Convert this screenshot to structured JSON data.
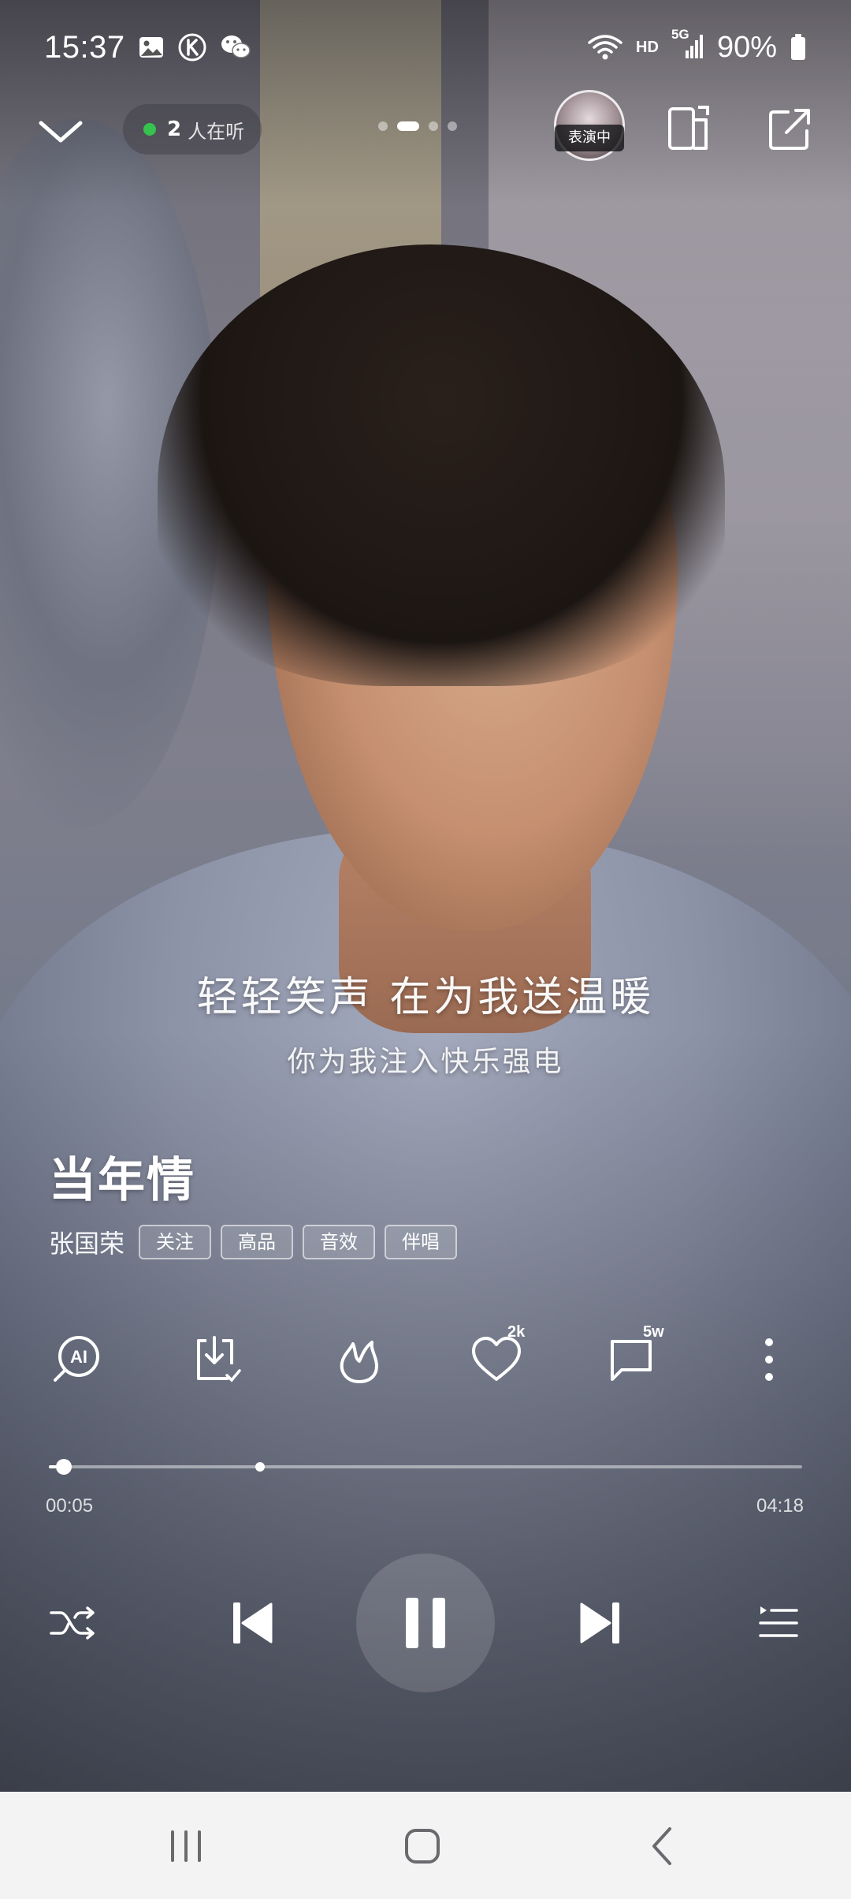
{
  "status_bar": {
    "time": "15:37",
    "network": "HD",
    "signal": "5G",
    "battery": "90%",
    "icons": [
      "gallery-icon",
      "k-app-icon",
      "wechat-icon",
      "wifi-icon",
      "signal-icon",
      "battery-icon"
    ]
  },
  "top_nav": {
    "listeners_count": "2",
    "listeners_label": "人在听",
    "performing_label": "表演中",
    "page_dots": 4,
    "active_page": 1
  },
  "lyrics": {
    "current": "轻轻笑声 在为我送温暖",
    "next": "你为我注入快乐强电"
  },
  "song": {
    "title": "当年情",
    "artist": "张国荣",
    "tags": [
      "关注",
      "高品",
      "音效",
      "伴唱"
    ]
  },
  "actions": {
    "ai_label": "AI",
    "likes": "2k",
    "comments": "5w"
  },
  "progress": {
    "current": "00:05",
    "total": "04:18",
    "played_fraction": 0.02,
    "marker_fraction": 0.28
  },
  "colors": {
    "listener_dot": "#36c24f",
    "nav_bar_bg": "#f3f3f4",
    "nav_icon": "#6a6a6e"
  }
}
